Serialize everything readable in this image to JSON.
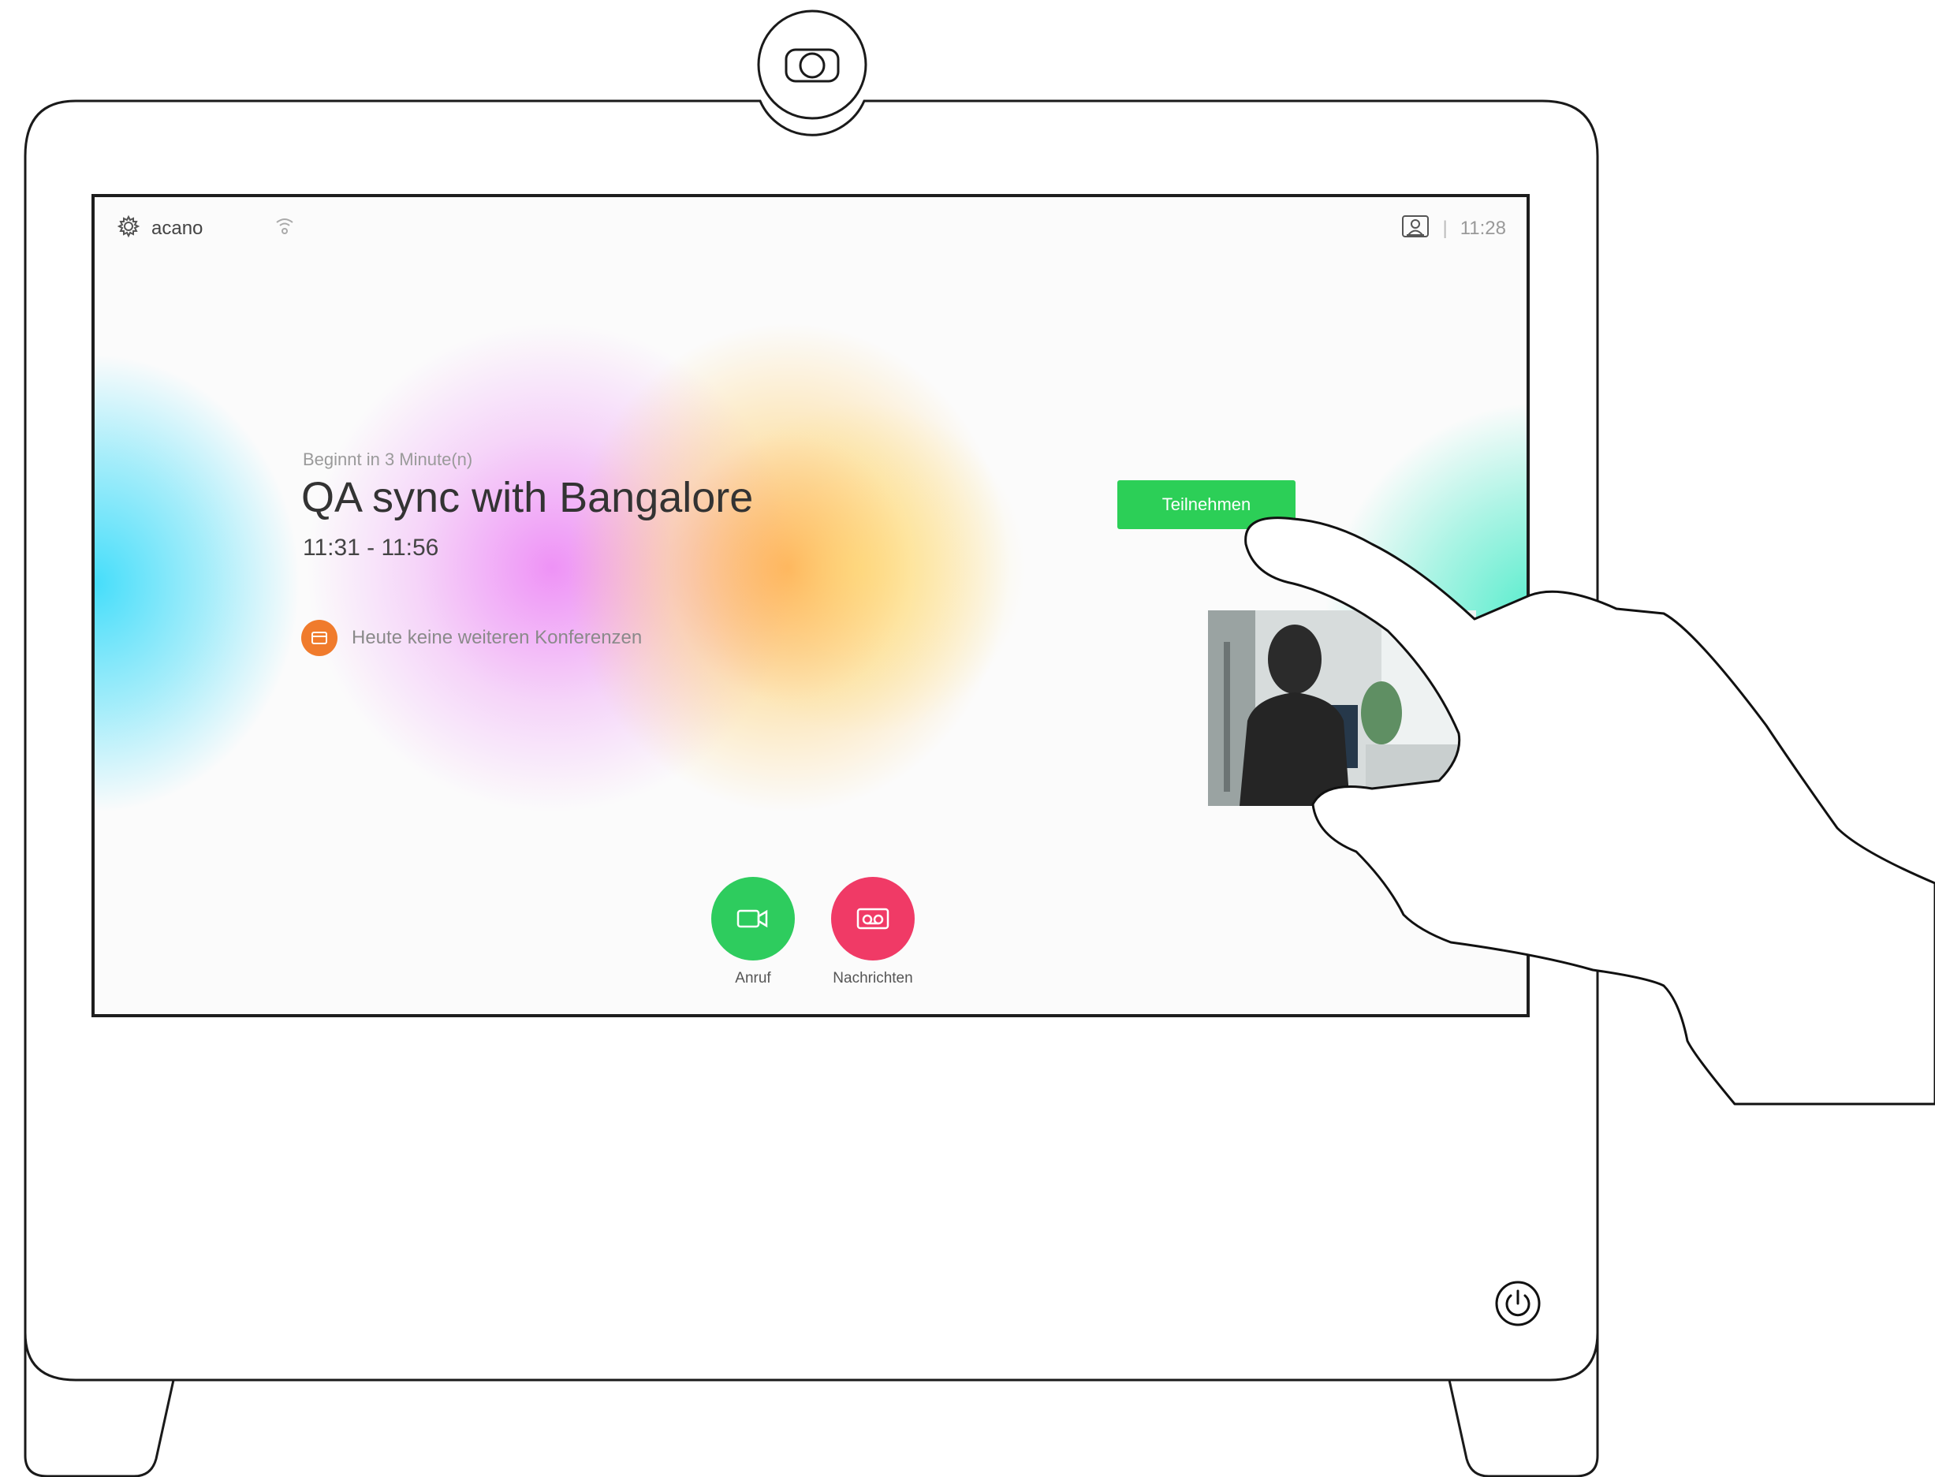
{
  "status_bar": {
    "device_name": "acano",
    "settings_icon": "gear-icon",
    "wifi_icon": "wifi-icon",
    "selfview_icon": "selfview-icon",
    "separator": "|",
    "time": "11:28"
  },
  "meeting": {
    "starts_in": "Beginnt in 3 Minute(n)",
    "title": "QA sync with Bangalore",
    "time_range": "11:31 - 11:56",
    "join_label": "Teilnehmen"
  },
  "notice": {
    "icon": "calendar-icon",
    "text": "Heute keine weiteren Konferenzen"
  },
  "actions": [
    {
      "label": "Anruf",
      "icon": "video-camera-icon",
      "color": "#2ecc5e"
    },
    {
      "label": "Nachrichten",
      "icon": "voicemail-icon",
      "color": "#f03a66"
    }
  ],
  "colors": {
    "join_button": "#2ccf57",
    "notice_icon": "#f07b2c"
  },
  "device": {
    "power_icon": "power-icon",
    "camera_icon": "camera-icon"
  }
}
